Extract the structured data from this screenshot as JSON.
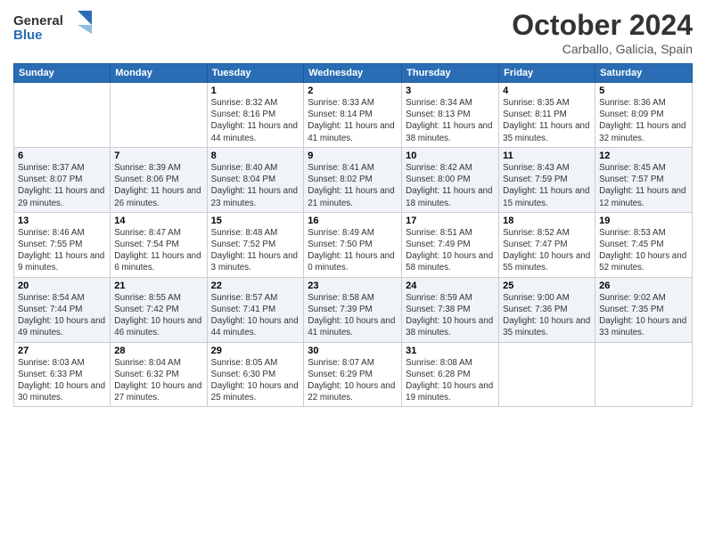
{
  "header": {
    "logo_general": "General",
    "logo_blue": "Blue",
    "month": "October 2024",
    "location": "Carballo, Galicia, Spain"
  },
  "days_of_week": [
    "Sunday",
    "Monday",
    "Tuesday",
    "Wednesday",
    "Thursday",
    "Friday",
    "Saturday"
  ],
  "weeks": [
    [
      {
        "day": "",
        "info": ""
      },
      {
        "day": "",
        "info": ""
      },
      {
        "day": "1",
        "info": "Sunrise: 8:32 AM\nSunset: 8:16 PM\nDaylight: 11 hours and 44 minutes."
      },
      {
        "day": "2",
        "info": "Sunrise: 8:33 AM\nSunset: 8:14 PM\nDaylight: 11 hours and 41 minutes."
      },
      {
        "day": "3",
        "info": "Sunrise: 8:34 AM\nSunset: 8:13 PM\nDaylight: 11 hours and 38 minutes."
      },
      {
        "day": "4",
        "info": "Sunrise: 8:35 AM\nSunset: 8:11 PM\nDaylight: 11 hours and 35 minutes."
      },
      {
        "day": "5",
        "info": "Sunrise: 8:36 AM\nSunset: 8:09 PM\nDaylight: 11 hours and 32 minutes."
      }
    ],
    [
      {
        "day": "6",
        "info": "Sunrise: 8:37 AM\nSunset: 8:07 PM\nDaylight: 11 hours and 29 minutes."
      },
      {
        "day": "7",
        "info": "Sunrise: 8:39 AM\nSunset: 8:06 PM\nDaylight: 11 hours and 26 minutes."
      },
      {
        "day": "8",
        "info": "Sunrise: 8:40 AM\nSunset: 8:04 PM\nDaylight: 11 hours and 23 minutes."
      },
      {
        "day": "9",
        "info": "Sunrise: 8:41 AM\nSunset: 8:02 PM\nDaylight: 11 hours and 21 minutes."
      },
      {
        "day": "10",
        "info": "Sunrise: 8:42 AM\nSunset: 8:00 PM\nDaylight: 11 hours and 18 minutes."
      },
      {
        "day": "11",
        "info": "Sunrise: 8:43 AM\nSunset: 7:59 PM\nDaylight: 11 hours and 15 minutes."
      },
      {
        "day": "12",
        "info": "Sunrise: 8:45 AM\nSunset: 7:57 PM\nDaylight: 11 hours and 12 minutes."
      }
    ],
    [
      {
        "day": "13",
        "info": "Sunrise: 8:46 AM\nSunset: 7:55 PM\nDaylight: 11 hours and 9 minutes."
      },
      {
        "day": "14",
        "info": "Sunrise: 8:47 AM\nSunset: 7:54 PM\nDaylight: 11 hours and 6 minutes."
      },
      {
        "day": "15",
        "info": "Sunrise: 8:48 AM\nSunset: 7:52 PM\nDaylight: 11 hours and 3 minutes."
      },
      {
        "day": "16",
        "info": "Sunrise: 8:49 AM\nSunset: 7:50 PM\nDaylight: 11 hours and 0 minutes."
      },
      {
        "day": "17",
        "info": "Sunrise: 8:51 AM\nSunset: 7:49 PM\nDaylight: 10 hours and 58 minutes."
      },
      {
        "day": "18",
        "info": "Sunrise: 8:52 AM\nSunset: 7:47 PM\nDaylight: 10 hours and 55 minutes."
      },
      {
        "day": "19",
        "info": "Sunrise: 8:53 AM\nSunset: 7:45 PM\nDaylight: 10 hours and 52 minutes."
      }
    ],
    [
      {
        "day": "20",
        "info": "Sunrise: 8:54 AM\nSunset: 7:44 PM\nDaylight: 10 hours and 49 minutes."
      },
      {
        "day": "21",
        "info": "Sunrise: 8:55 AM\nSunset: 7:42 PM\nDaylight: 10 hours and 46 minutes."
      },
      {
        "day": "22",
        "info": "Sunrise: 8:57 AM\nSunset: 7:41 PM\nDaylight: 10 hours and 44 minutes."
      },
      {
        "day": "23",
        "info": "Sunrise: 8:58 AM\nSunset: 7:39 PM\nDaylight: 10 hours and 41 minutes."
      },
      {
        "day": "24",
        "info": "Sunrise: 8:59 AM\nSunset: 7:38 PM\nDaylight: 10 hours and 38 minutes."
      },
      {
        "day": "25",
        "info": "Sunrise: 9:00 AM\nSunset: 7:36 PM\nDaylight: 10 hours and 35 minutes."
      },
      {
        "day": "26",
        "info": "Sunrise: 9:02 AM\nSunset: 7:35 PM\nDaylight: 10 hours and 33 minutes."
      }
    ],
    [
      {
        "day": "27",
        "info": "Sunrise: 8:03 AM\nSunset: 6:33 PM\nDaylight: 10 hours and 30 minutes."
      },
      {
        "day": "28",
        "info": "Sunrise: 8:04 AM\nSunset: 6:32 PM\nDaylight: 10 hours and 27 minutes."
      },
      {
        "day": "29",
        "info": "Sunrise: 8:05 AM\nSunset: 6:30 PM\nDaylight: 10 hours and 25 minutes."
      },
      {
        "day": "30",
        "info": "Sunrise: 8:07 AM\nSunset: 6:29 PM\nDaylight: 10 hours and 22 minutes."
      },
      {
        "day": "31",
        "info": "Sunrise: 8:08 AM\nSunset: 6:28 PM\nDaylight: 10 hours and 19 minutes."
      },
      {
        "day": "",
        "info": ""
      },
      {
        "day": "",
        "info": ""
      }
    ]
  ]
}
